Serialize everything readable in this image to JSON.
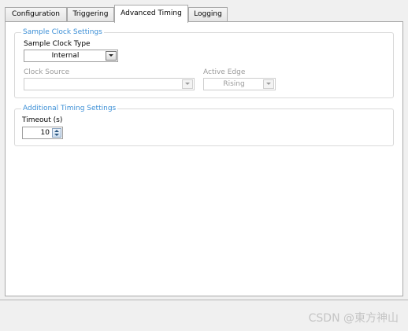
{
  "tabs": [
    {
      "label": "Configuration"
    },
    {
      "label": "Triggering"
    },
    {
      "label": "Advanced Timing",
      "active": true
    },
    {
      "label": "Logging"
    }
  ],
  "sample_clock": {
    "group_title": "Sample Clock Settings",
    "type_label": "Sample Clock Type",
    "type_value": "Internal",
    "source_label": "Clock Source",
    "source_value": "",
    "edge_label": "Active Edge",
    "edge_value": "Rising"
  },
  "additional_timing": {
    "group_title": "Additional Timing Settings",
    "timeout_label": "Timeout (s)",
    "timeout_value": "10"
  },
  "watermark": "CSDN @東方神山"
}
